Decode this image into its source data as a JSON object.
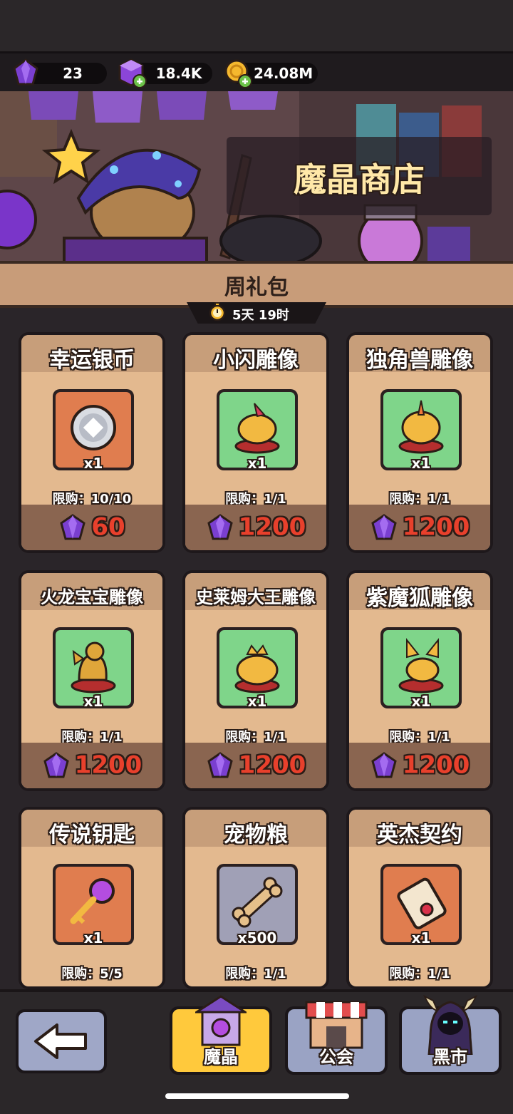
{
  "resources": [
    {
      "icon": "purple-gem-icon",
      "value": "23"
    },
    {
      "icon": "purple-cube-plus-icon",
      "value": "18.4K"
    },
    {
      "icon": "gold-coin-plus-icon",
      "value": "24.08M"
    }
  ],
  "banner": {
    "shop_title": "魔晶商店"
  },
  "section": {
    "title": "周礼包",
    "timer": "5天 19时"
  },
  "cards": [
    {
      "name": "幸运银币",
      "qty": "x1",
      "limit": "限购：10/10",
      "price": "60",
      "icon": "silver-coin-icon",
      "bg": "orange"
    },
    {
      "name": "小闪雕像",
      "qty": "x1",
      "limit": "限购：1/1",
      "price": "1200",
      "icon": "statue-icon",
      "bg": "green"
    },
    {
      "name": "独角兽雕像",
      "qty": "x1",
      "limit": "限购：1/1",
      "price": "1200",
      "icon": "unicorn-statue-icon",
      "bg": "green"
    },
    {
      "name": "火龙宝宝雕像",
      "qty": "x1",
      "limit": "限购：1/1",
      "price": "1200",
      "icon": "dragon-statue-icon",
      "bg": "green"
    },
    {
      "name": "史莱姆大王雕像",
      "qty": "x1",
      "limit": "限购：1/1",
      "price": "1200",
      "icon": "slime-king-statue-icon",
      "bg": "green"
    },
    {
      "name": "紫魔狐雕像",
      "qty": "x1",
      "limit": "限购：1/1",
      "price": "1200",
      "icon": "fox-statue-icon",
      "bg": "green"
    },
    {
      "name": "传说钥匙",
      "qty": "x1",
      "limit": "限购：5/5",
      "price": "",
      "icon": "legend-key-icon",
      "bg": "orange"
    },
    {
      "name": "宠物粮",
      "qty": "x500",
      "limit": "限购：1/1",
      "price": "",
      "icon": "bone-icon",
      "bg": "gray"
    },
    {
      "name": "英杰契约",
      "qty": "x1",
      "limit": "限购：1/1",
      "price": "",
      "icon": "scroll-icon",
      "bg": "orange"
    }
  ],
  "nav": {
    "back": "back-arrow-icon",
    "tab_magic": "魔晶",
    "tab_guild": "公会",
    "tab_black": "黑市"
  },
  "colors": {
    "accent": "#ffd24a",
    "price_red": "#e8402c",
    "card_bg": "#e3b98f",
    "title_bg": "#c79e7a"
  }
}
